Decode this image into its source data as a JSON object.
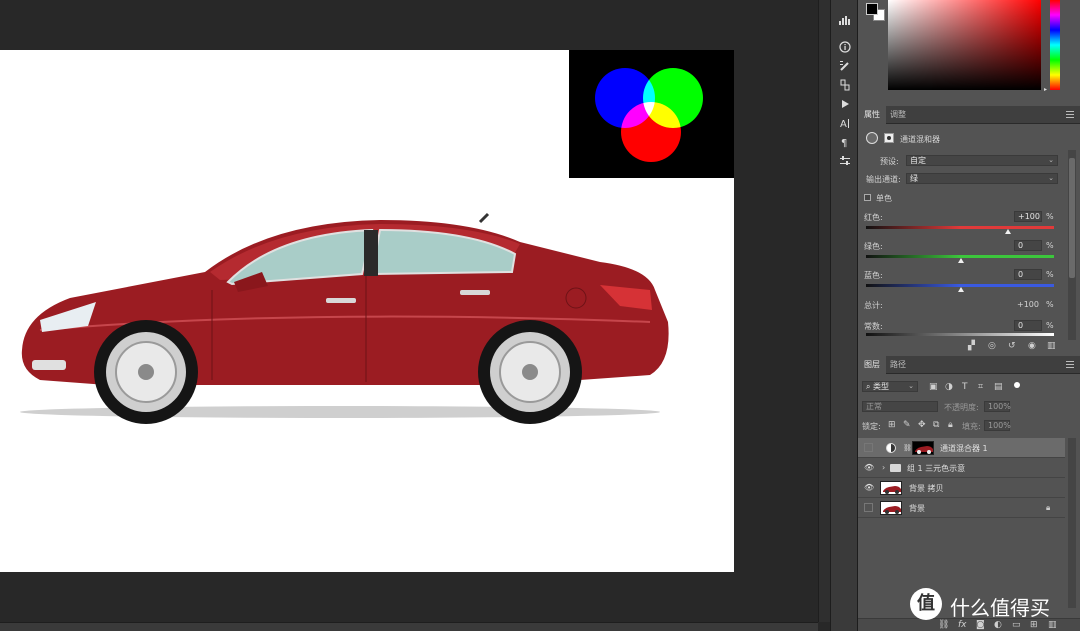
{
  "properties_panel": {
    "tabs": [
      "属性",
      "调整"
    ],
    "title": "通道混和器",
    "preset_label": "预设:",
    "preset_value": "自定",
    "output_channel_label": "输出通道:",
    "output_channel_value": "绿",
    "monochrome_label": "单色",
    "sliders": [
      {
        "label": "红色:",
        "value": "+100",
        "unit": "%",
        "position": 1.0,
        "gradient": "red"
      },
      {
        "label": "绿色:",
        "value": "0",
        "unit": "%",
        "position": 0.5,
        "gradient": "green"
      },
      {
        "label": "蓝色:",
        "value": "0",
        "unit": "%",
        "position": 0.5,
        "gradient": "blue"
      }
    ],
    "total_label": "总计:",
    "total_value": "+100",
    "total_unit": "%",
    "constant_label": "常数:",
    "constant_value": "0",
    "constant_unit": "%"
  },
  "layers_panel": {
    "tabs": [
      "图层",
      "路径"
    ],
    "filter_label": "类型",
    "blend_mode": "正常",
    "opacity_label": "不透明度:",
    "opacity_value": "100%",
    "lock_label": "锁定:",
    "fill_label": "填充:",
    "fill_value": "100%",
    "layers": [
      {
        "name": "通道混合器 1",
        "visible": false,
        "type": "adjustment",
        "selected": true
      },
      {
        "name": "组 1 三元色示意",
        "visible": true,
        "type": "group",
        "selected": false
      },
      {
        "name": "背景 拷贝",
        "visible": true,
        "type": "image",
        "selected": false
      },
      {
        "name": "背景",
        "visible": false,
        "type": "image-locked",
        "selected": false
      }
    ],
    "footer_icons": [
      "link-icon",
      "fx-icon",
      "mask-icon",
      "adjustment-icon",
      "group-icon",
      "new-layer-icon",
      "trash-icon"
    ]
  },
  "tools": [
    "histogram-icon",
    "info-icon",
    "brush-settings-icon",
    "clone-source-icon",
    "actions-play-icon",
    "character-icon",
    "paragraph-icon",
    "properties-sliders-icon"
  ],
  "colors": {
    "car_red": "#9b1c22",
    "circle_red": "#ff0000",
    "circle_green": "#00ff00",
    "circle_blue": "#0000ff",
    "panel_bg": "#535353",
    "workspace_bg": "#282828"
  },
  "watermark": {
    "logo_glyph": "值",
    "text": "什么值得买"
  },
  "footer_label": "fx"
}
